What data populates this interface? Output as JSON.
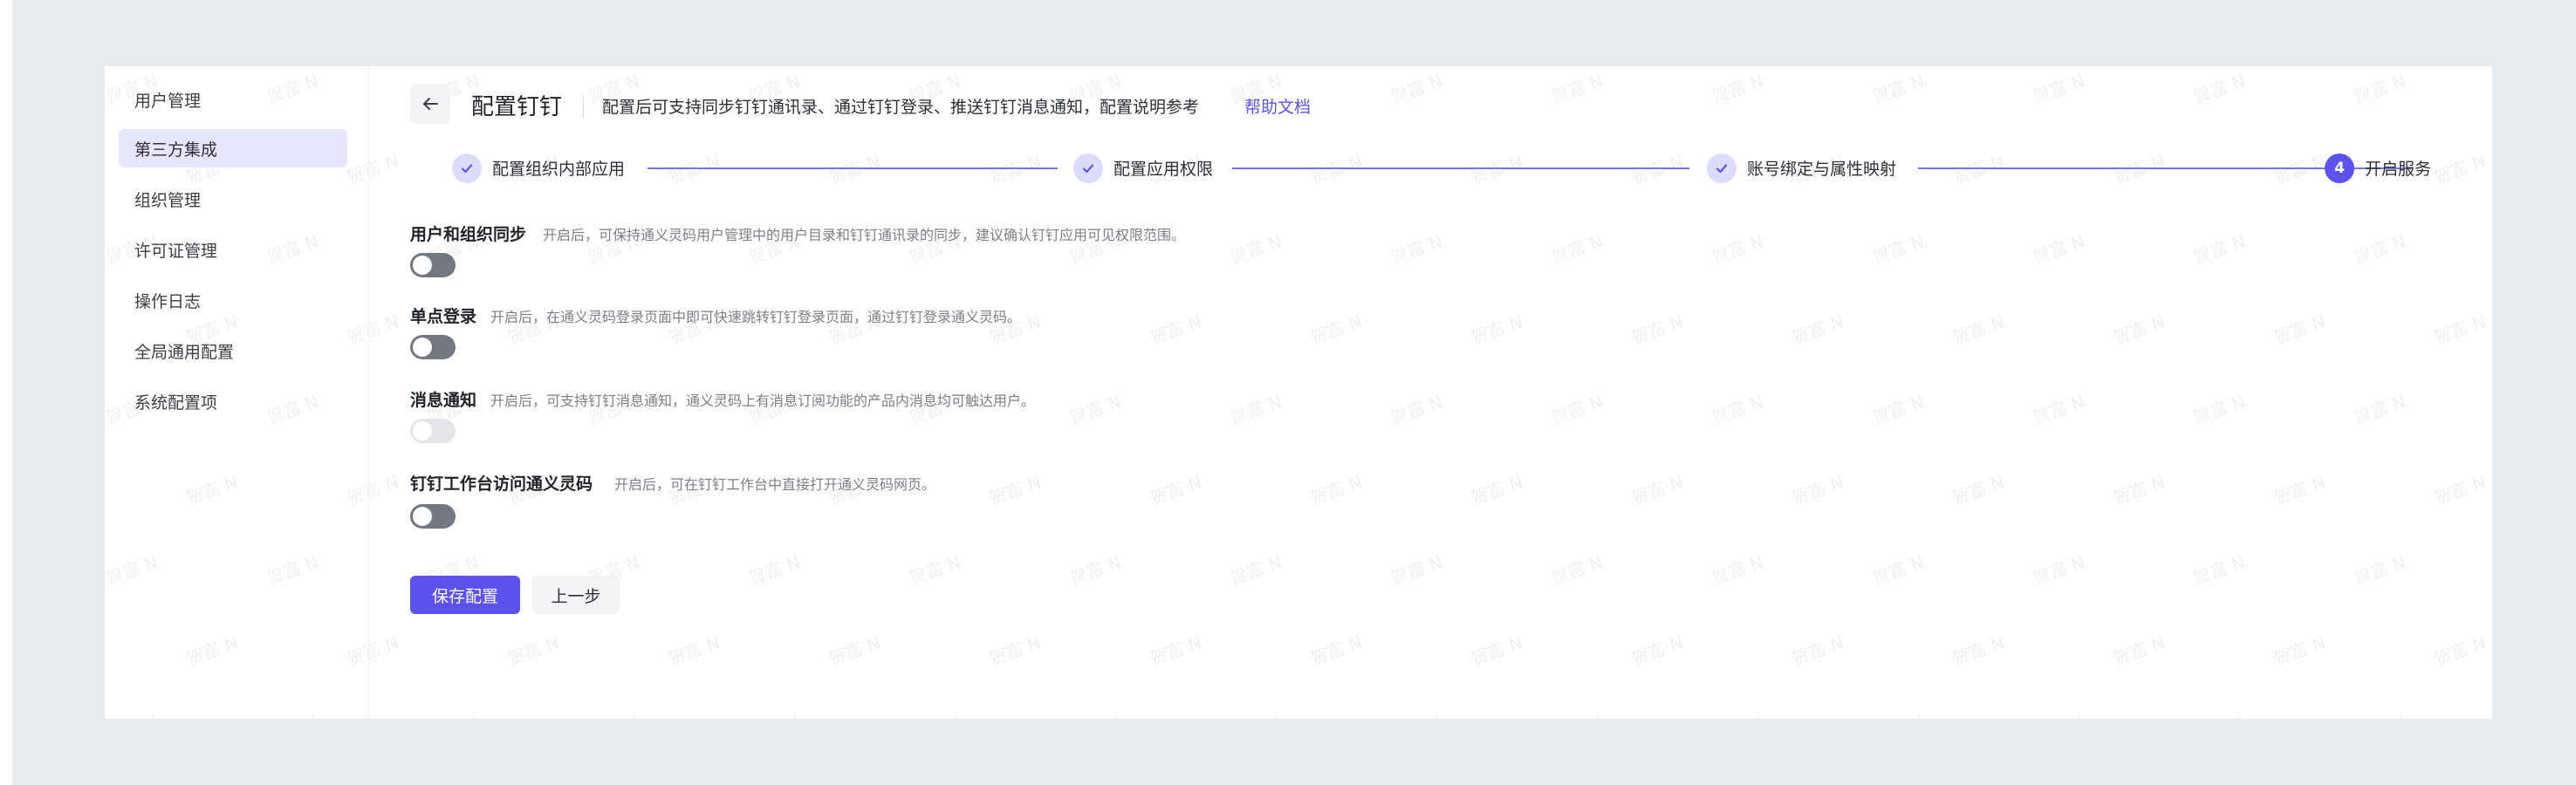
{
  "sidebar": {
    "items": [
      {
        "label": "用户管理",
        "active": false
      },
      {
        "label": "第三方集成",
        "active": true
      },
      {
        "label": "组织管理",
        "active": false
      },
      {
        "label": "许可证管理",
        "active": false
      },
      {
        "label": "操作日志",
        "active": false
      },
      {
        "label": "全局通用配置",
        "active": false
      },
      {
        "label": "系统配置项",
        "active": false
      }
    ]
  },
  "header": {
    "back_icon": "arrow-left-icon",
    "title": "配置钉钉",
    "description": "配置后可支持同步钉钉通讯录、通过钉钉登录、推送钉钉消息通知，配置说明参考",
    "help_link": "帮助文档"
  },
  "steps": [
    {
      "label": "配置组织内部应用",
      "status": "done"
    },
    {
      "label": "配置应用权限",
      "status": "done"
    },
    {
      "label": "账号绑定与属性映射",
      "status": "done"
    },
    {
      "label": "开启服务",
      "status": "current",
      "number": "4"
    }
  ],
  "settings": [
    {
      "title": "用户和组织同步",
      "desc": "开启后，可保持通义灵码用户管理中的用户目录和钉钉通讯录的同步，建议确认钉钉应用可见权限范围。",
      "enabled": false,
      "disabled": false
    },
    {
      "title": "单点登录",
      "desc": "开启后，在通义灵码登录页面中即可快速跳转钉钉登录页面，通过钉钉登录通义灵码。",
      "enabled": false,
      "disabled": false
    },
    {
      "title": "消息通知",
      "desc": "开启后，可支持钉钉消息通知，通义灵码上有消息订阅功能的产品内消息均可触达用户。",
      "enabled": false,
      "disabled": true
    },
    {
      "title": "钉钉工作台访问通义灵码",
      "desc": "开启后，可在钉钉工作台中直接打开通义灵码网页。",
      "enabled": false,
      "disabled": false
    }
  ],
  "actions": {
    "save_label": "保存配置",
    "prev_label": "上一步"
  },
  "watermark_text": "贺富 N",
  "colors": {
    "accent": "#5b52f0",
    "sidebar_active_bg": "#e7e6ff",
    "toggle_off": "#737780",
    "page_bg": "#e9ecef"
  }
}
